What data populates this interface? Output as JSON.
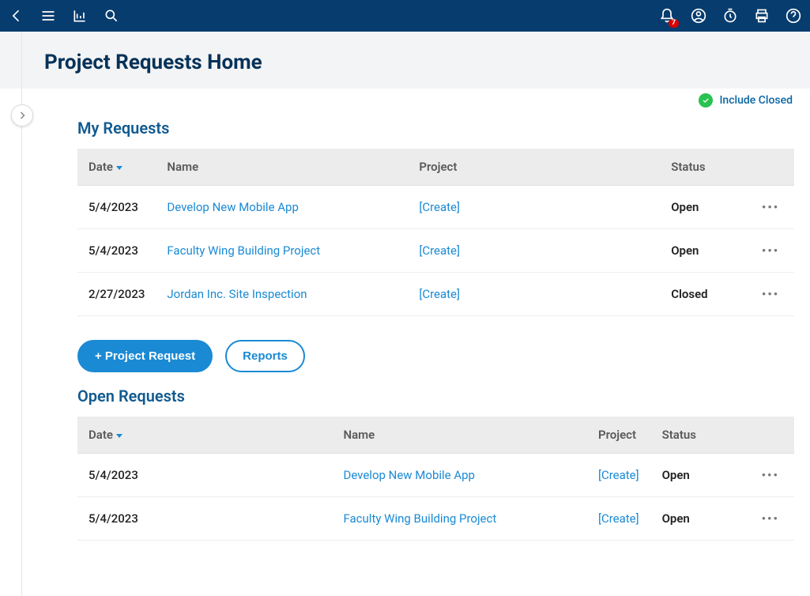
{
  "topbar": {
    "notification_badge": "7"
  },
  "header": {
    "title": "Project Requests Home"
  },
  "include_closed_label": "Include Closed",
  "my_requests": {
    "title": "My Requests",
    "columns": {
      "date": "Date",
      "name": "Name",
      "project": "Project",
      "status": "Status"
    },
    "rows": [
      {
        "date": "5/4/2023",
        "name": "Develop New Mobile App",
        "project": "[Create]",
        "status": "Open"
      },
      {
        "date": "5/4/2023",
        "name": "Faculty Wing Building Project",
        "project": "[Create]",
        "status": "Open"
      },
      {
        "date": "2/27/2023",
        "name": "Jordan Inc. Site Inspection",
        "project": "[Create]",
        "status": "Closed"
      }
    ]
  },
  "buttons": {
    "project_request": "+ Project Request",
    "reports": "Reports"
  },
  "open_requests": {
    "title": "Open Requests",
    "columns": {
      "date": "Date",
      "name": "Name",
      "project": "Project",
      "status": "Status"
    },
    "rows": [
      {
        "date": "5/4/2023",
        "name": "Develop New Mobile App",
        "project": "[Create]",
        "status": "Open"
      },
      {
        "date": "5/4/2023",
        "name": "Faculty Wing Building Project",
        "project": "[Create]",
        "status": "Open"
      }
    ]
  }
}
